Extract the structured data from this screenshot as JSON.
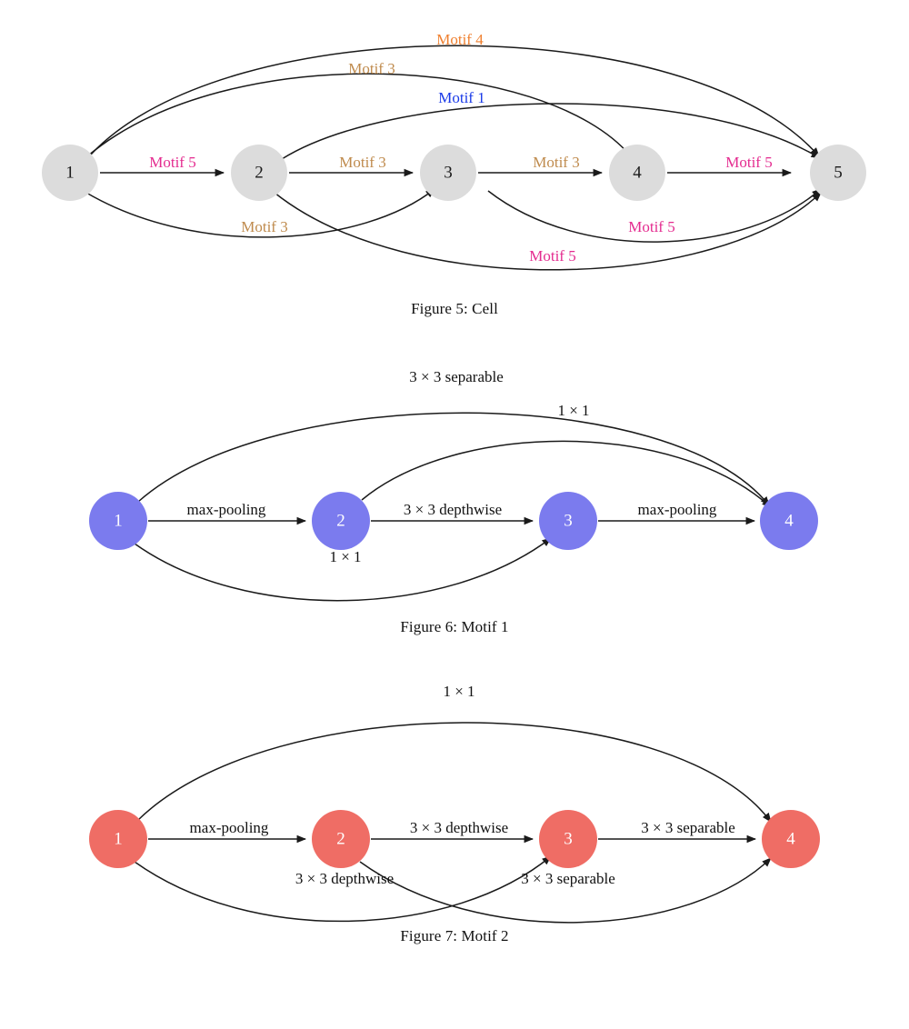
{
  "figures": [
    {
      "id": "cell",
      "caption": "Figure 5: Cell",
      "node_fill": "#dcdcdc",
      "node_text_color": "#1a1a1a",
      "nodes": [
        {
          "id": "1",
          "label": "1"
        },
        {
          "id": "2",
          "label": "2"
        },
        {
          "id": "3",
          "label": "3"
        },
        {
          "id": "4",
          "label": "4"
        },
        {
          "id": "5",
          "label": "5"
        }
      ],
      "edges": [
        {
          "from": "1",
          "to": "5",
          "label": "Motif 4",
          "color": "#ef7f2e",
          "route": "arc-top-far"
        },
        {
          "from": "1",
          "to": "4",
          "label": "Motif 3",
          "color": "#bf8a4c",
          "route": "arc-top-mid"
        },
        {
          "from": "2",
          "to": "5",
          "label": "Motif 1",
          "color": "#1a3ae8",
          "route": "arc-top-near"
        },
        {
          "from": "1",
          "to": "2",
          "label": "Motif 5",
          "color": "#e42b8f",
          "route": "straight"
        },
        {
          "from": "2",
          "to": "3",
          "label": "Motif 3",
          "color": "#bf8a4c",
          "route": "straight"
        },
        {
          "from": "3",
          "to": "4",
          "label": "Motif 3",
          "color": "#bf8a4c",
          "route": "straight"
        },
        {
          "from": "4",
          "to": "5",
          "label": "Motif 5",
          "color": "#e42b8f",
          "route": "straight"
        },
        {
          "from": "1",
          "to": "3",
          "label": "Motif 3",
          "color": "#bf8a4c",
          "route": "arc-bottom-near"
        },
        {
          "from": "3",
          "to": "5",
          "label": "Motif 5",
          "color": "#e42b8f",
          "route": "arc-bottom-mid"
        },
        {
          "from": "2",
          "to": "5",
          "label": "Motif 5",
          "color": "#e42b8f",
          "route": "arc-bottom-far"
        }
      ]
    },
    {
      "id": "motif1",
      "caption": "Figure 6: Motif 1",
      "node_fill": "#7b7bee",
      "node_text_color": "#ffffff",
      "nodes": [
        {
          "id": "1",
          "label": "1"
        },
        {
          "id": "2",
          "label": "2"
        },
        {
          "id": "3",
          "label": "3"
        },
        {
          "id": "4",
          "label": "4"
        }
      ],
      "edges": [
        {
          "from": "1",
          "to": "4",
          "label": "3 × 3 separable",
          "color": "#111111",
          "route": "arc-top-far"
        },
        {
          "from": "2",
          "to": "4",
          "label": "1 × 1",
          "color": "#111111",
          "route": "arc-top-near"
        },
        {
          "from": "1",
          "to": "2",
          "label": "max-pooling",
          "color": "#111111",
          "route": "straight"
        },
        {
          "from": "2",
          "to": "3",
          "label": "3 × 3 depthwise",
          "color": "#111111",
          "route": "straight"
        },
        {
          "from": "3",
          "to": "4",
          "label": "max-pooling",
          "color": "#111111",
          "route": "straight"
        },
        {
          "from": "1",
          "to": "3",
          "label": "1 × 1",
          "color": "#111111",
          "route": "arc-bottom-near"
        }
      ]
    },
    {
      "id": "motif2",
      "caption": "Figure 7: Motif 2",
      "node_fill": "#ef6d65",
      "node_text_color": "#ffffff",
      "nodes": [
        {
          "id": "1",
          "label": "1"
        },
        {
          "id": "2",
          "label": "2"
        },
        {
          "id": "3",
          "label": "3"
        },
        {
          "id": "4",
          "label": "4"
        }
      ],
      "edges": [
        {
          "from": "1",
          "to": "4",
          "label": "1 × 1",
          "color": "#111111",
          "route": "arc-top-far"
        },
        {
          "from": "1",
          "to": "2",
          "label": "max-pooling",
          "color": "#111111",
          "route": "straight"
        },
        {
          "from": "2",
          "to": "3",
          "label": "3 × 3 depthwise",
          "color": "#111111",
          "route": "straight"
        },
        {
          "from": "3",
          "to": "4",
          "label": "3 × 3 separable",
          "color": "#111111",
          "route": "straight"
        },
        {
          "from": "1",
          "to": "3",
          "label": "3 × 3 depthwise",
          "color": "#111111",
          "route": "arc-bottom-cross-a"
        },
        {
          "from": "2",
          "to": "4",
          "label": "3 × 3 separable",
          "color": "#111111",
          "route": "arc-bottom-cross-b"
        }
      ]
    }
  ],
  "chart_data": {
    "type": "diagram",
    "title": "Neural architecture cell and motif directed graphs",
    "graphs": [
      {
        "name": "Cell",
        "caption": "Figure 5: Cell",
        "nodes": [
          "1",
          "2",
          "3",
          "4",
          "5"
        ],
        "edges": [
          {
            "source": "1",
            "target": "2",
            "op": "Motif 5"
          },
          {
            "source": "1",
            "target": "3",
            "op": "Motif 3"
          },
          {
            "source": "1",
            "target": "4",
            "op": "Motif 3"
          },
          {
            "source": "1",
            "target": "5",
            "op": "Motif 4"
          },
          {
            "source": "2",
            "target": "3",
            "op": "Motif 3"
          },
          {
            "source": "2",
            "target": "5",
            "op": "Motif 1"
          },
          {
            "source": "2",
            "target": "5",
            "op": "Motif 5"
          },
          {
            "source": "3",
            "target": "4",
            "op": "Motif 3"
          },
          {
            "source": "3",
            "target": "5",
            "op": "Motif 5"
          },
          {
            "source": "4",
            "target": "5",
            "op": "Motif 5"
          }
        ]
      },
      {
        "name": "Motif 1",
        "caption": "Figure 6: Motif 1",
        "nodes": [
          "1",
          "2",
          "3",
          "4"
        ],
        "edges": [
          {
            "source": "1",
            "target": "2",
            "op": "max-pooling"
          },
          {
            "source": "1",
            "target": "3",
            "op": "1 × 1"
          },
          {
            "source": "1",
            "target": "4",
            "op": "3 × 3 separable"
          },
          {
            "source": "2",
            "target": "3",
            "op": "3 × 3 depthwise"
          },
          {
            "source": "2",
            "target": "4",
            "op": "1 × 1"
          },
          {
            "source": "3",
            "target": "4",
            "op": "max-pooling"
          }
        ]
      },
      {
        "name": "Motif 2",
        "caption": "Figure 7: Motif 2",
        "nodes": [
          "1",
          "2",
          "3",
          "4"
        ],
        "edges": [
          {
            "source": "1",
            "target": "2",
            "op": "max-pooling"
          },
          {
            "source": "1",
            "target": "3",
            "op": "3 × 3 depthwise"
          },
          {
            "source": "1",
            "target": "4",
            "op": "1 × 1"
          },
          {
            "source": "2",
            "target": "3",
            "op": "3 × 3 depthwise"
          },
          {
            "source": "2",
            "target": "4",
            "op": "3 × 3 separable"
          },
          {
            "source": "3",
            "target": "4",
            "op": "3 × 3 separable"
          }
        ]
      }
    ]
  }
}
